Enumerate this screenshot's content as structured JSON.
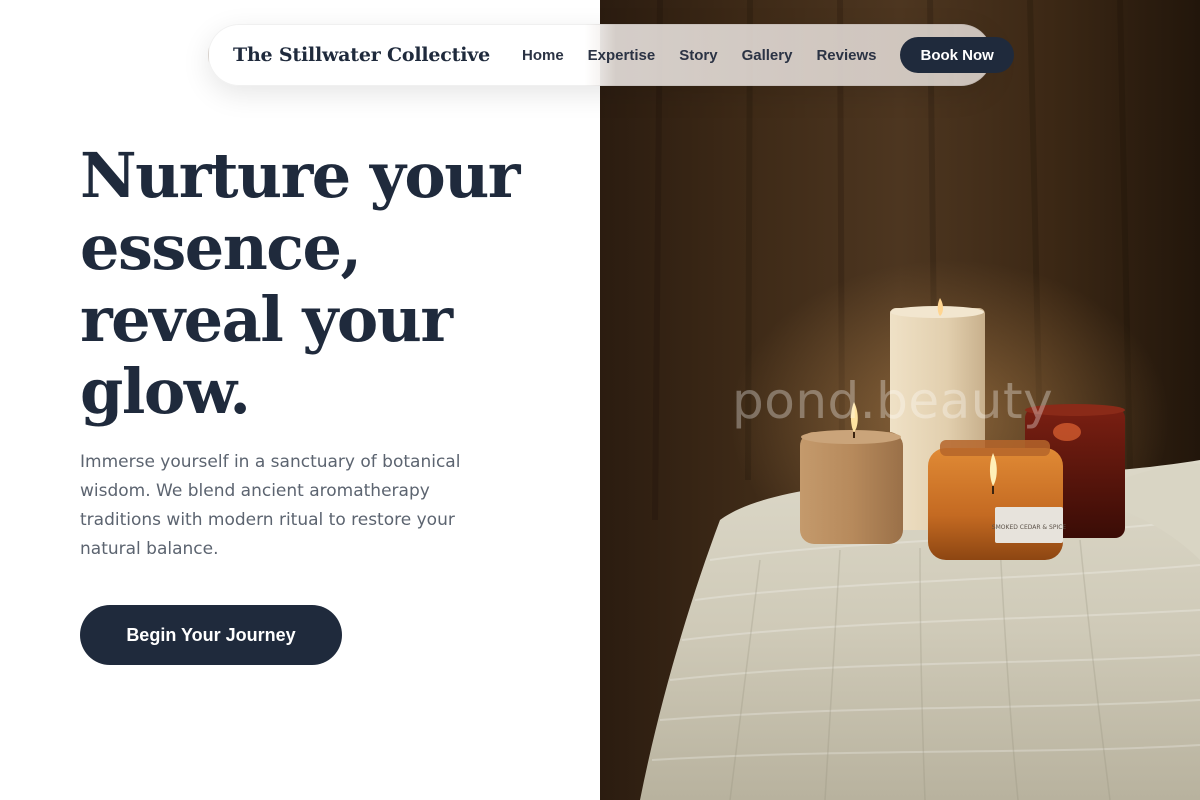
{
  "nav": {
    "brand": "The Stillwater Collective",
    "links": [
      "Home",
      "Expertise",
      "Story",
      "Gallery",
      "Reviews"
    ],
    "cta_label": "Book Now"
  },
  "hero": {
    "headline": "Nurture your essence, reveal your glow.",
    "body": "Immerse yourself in a sanctuary of botanical wisdom. We blend ancient aromatherapy traditions with modern ritual to restore your natural balance.",
    "cta_label": "Begin Your Journey"
  },
  "image": {
    "watermark": "pond.beauty",
    "jar_label": "SMOKED CEDAR & SPICE"
  },
  "colors": {
    "brand_navy": "#1f2a3c",
    "body_text": "#5c6470",
    "background": "#ffffff"
  }
}
